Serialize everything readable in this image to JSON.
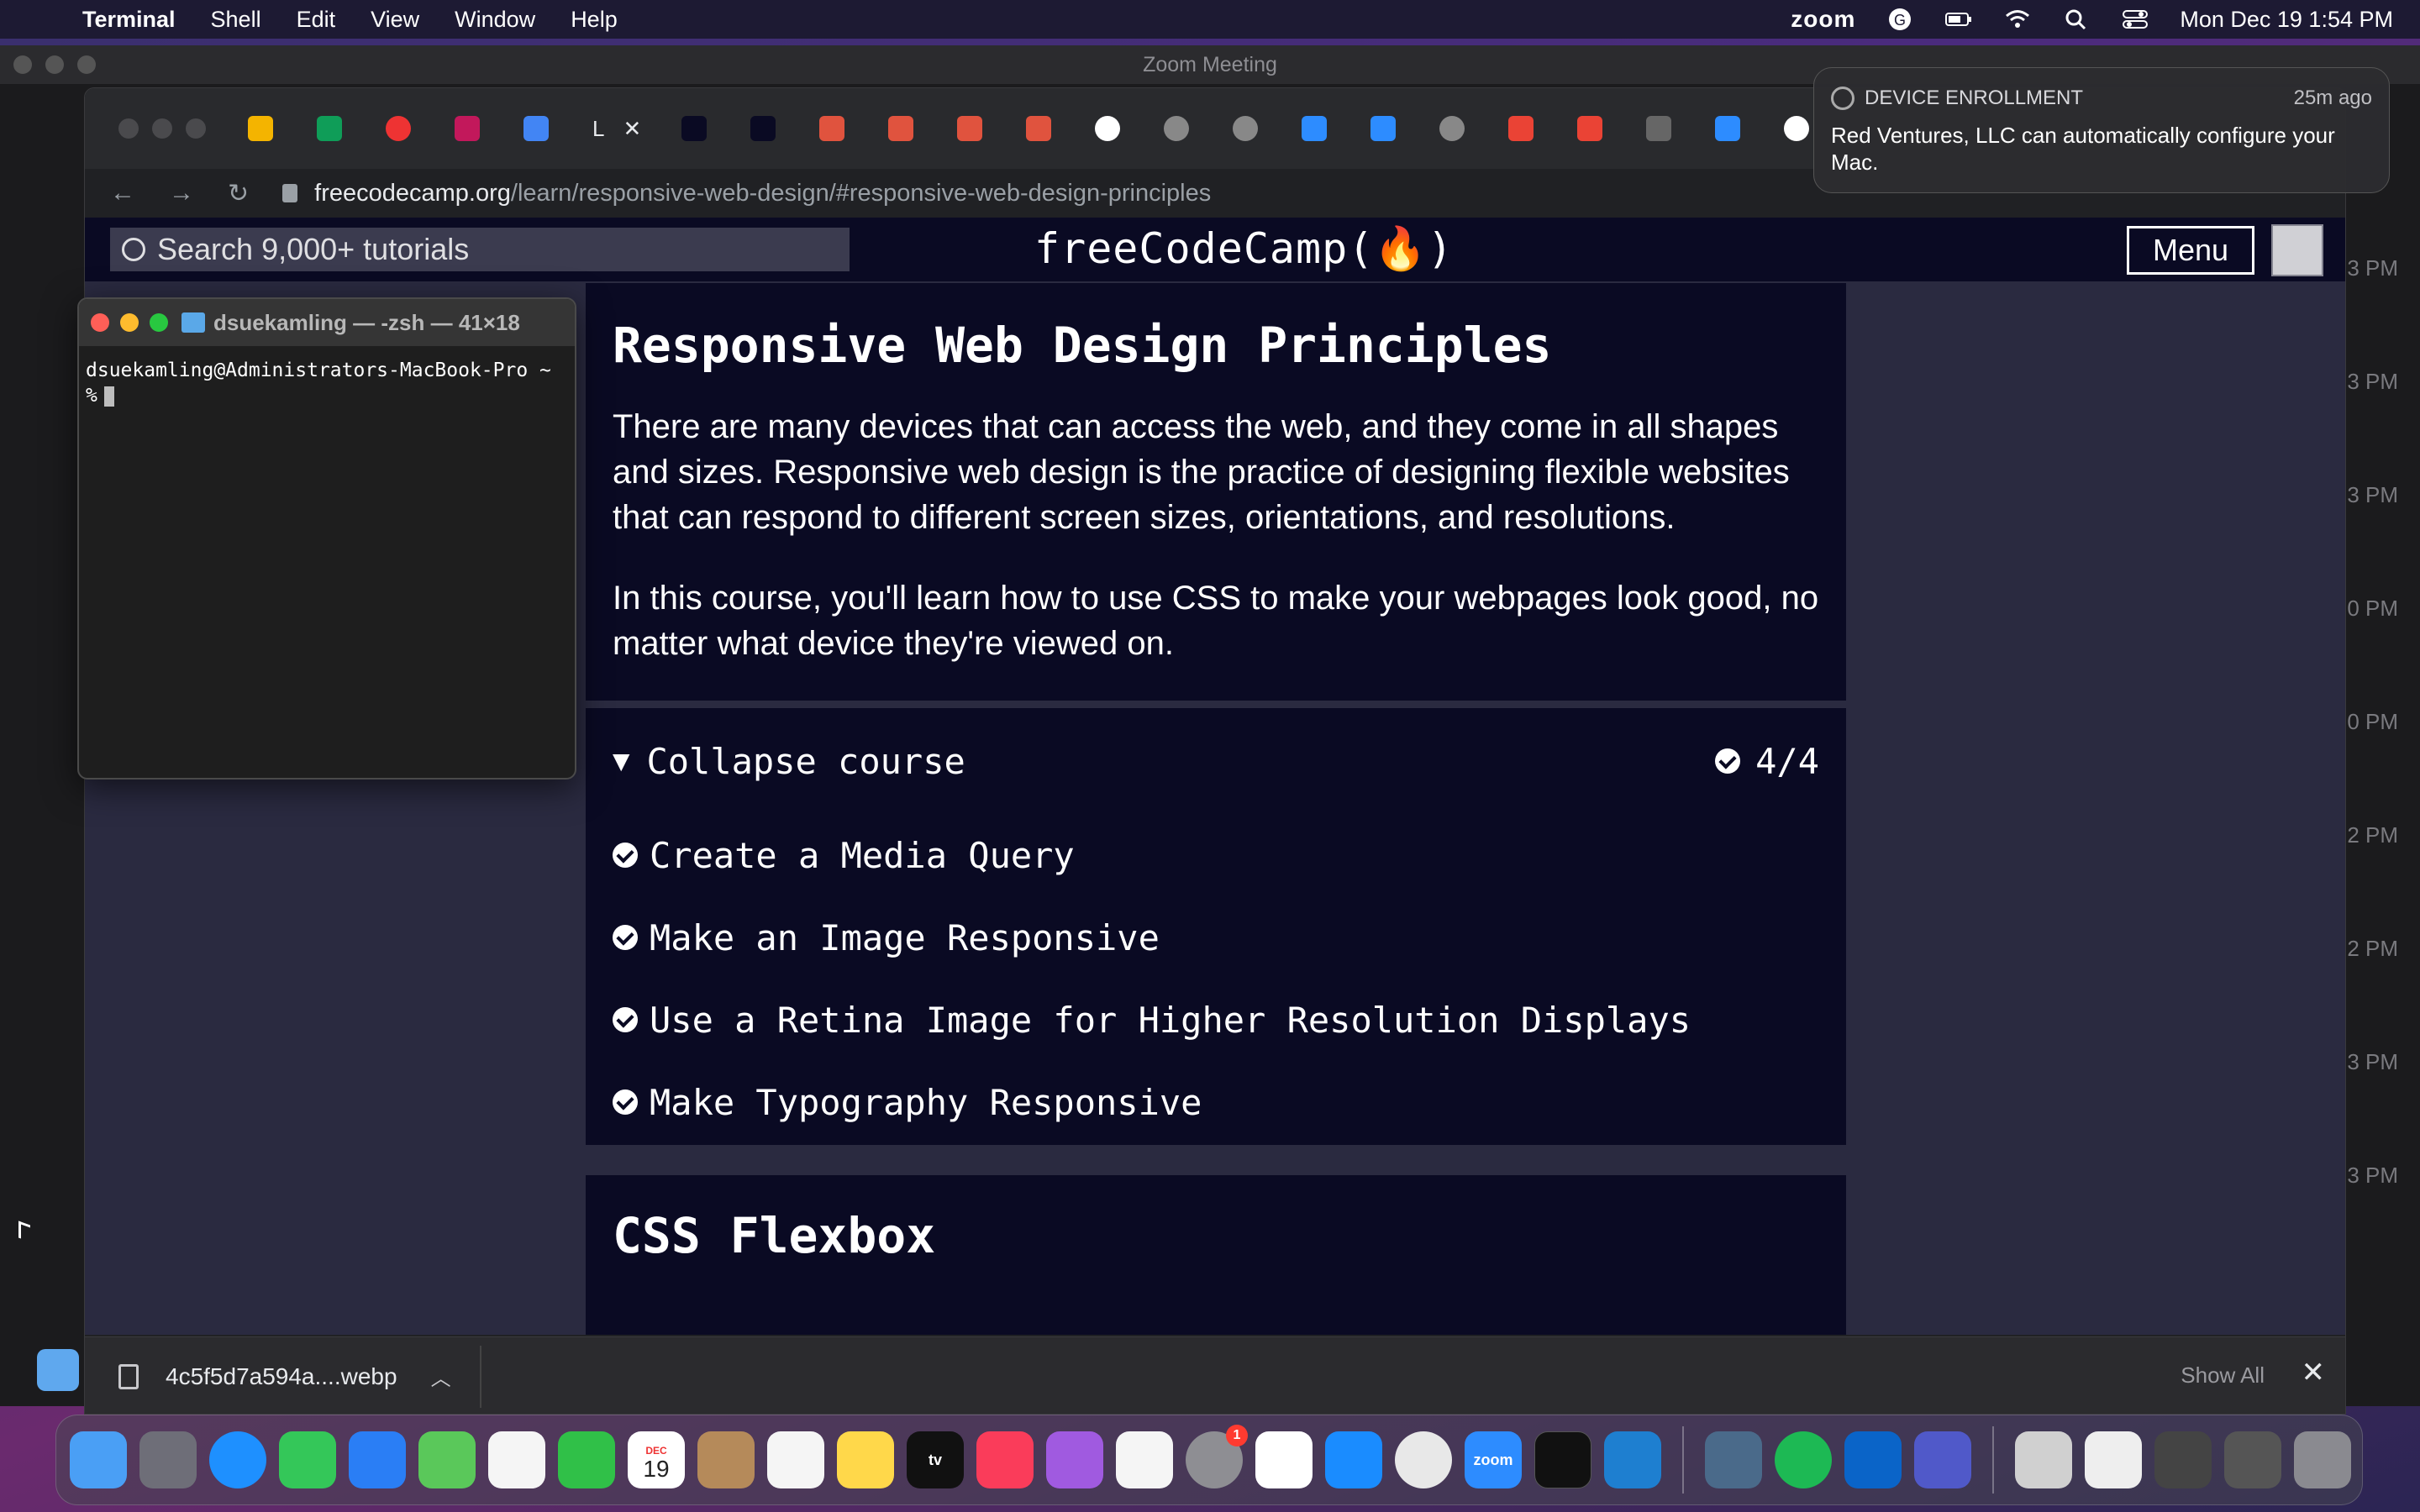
{
  "menubar": {
    "app_name": "Terminal",
    "items": [
      "Shell",
      "Edit",
      "View",
      "Window",
      "Help"
    ],
    "zoom_label": "zoom",
    "datetime": "Mon Dec 19  1:54 PM"
  },
  "zoom_window": {
    "title": "Zoom Meeting",
    "times": [
      "3 PM",
      "3 PM",
      "3 PM",
      "0 PM",
      "0 PM",
      "2 PM",
      "2 PM",
      "3 PM",
      "3 PM"
    ]
  },
  "browser": {
    "active_tab_label": "L",
    "url_host": "freecodecamp.org",
    "url_path": "/learn/responsive-web-design/#responsive-web-design-principles"
  },
  "fcc": {
    "search_placeholder": "Search 9,000+ tutorials",
    "logo": "freeCodeCamp(🔥)",
    "menu_label": "Menu",
    "intro": {
      "title": "Responsive Web Design Principles",
      "paragraphs": [
        "There are many devices that can access the web, and they come in all shapes and sizes. Responsive web design is the practice of designing flexible websites that can respond to different screen sizes, orientations, and resolutions.",
        "In this course, you'll learn how to use CSS to make your webpages look good, no matter what device they're viewed on."
      ]
    },
    "course": {
      "toggle_label": "Collapse course",
      "progress": "4/4",
      "lessons": [
        "Create a Media Query",
        "Make an Image Responsive",
        "Use a Retina Image for Higher Resolution Displays",
        "Make Typography Responsive"
      ]
    },
    "next_section_title": "CSS Flexbox"
  },
  "download_bar": {
    "filename": "4c5f5d7a594a....webp",
    "show_all": "Show All",
    "close": "✕"
  },
  "terminal": {
    "title": "dsuekamling — -zsh — 41×18",
    "line1": "dsuekamling@Administrators-MacBook-Pro ~",
    "prompt": "%"
  },
  "notification": {
    "app": "DEVICE ENROLLMENT",
    "time": "25m ago",
    "message": "Red Ventures, LLC can automatically configure your Mac."
  },
  "dock": {
    "calendar_month": "DEC",
    "calendar_day": "19",
    "zoom_label": "zoom",
    "settings_badge": "1",
    "tv_label": "tv"
  },
  "colors": {
    "fcc_bg": "#0a0a23",
    "fcc_page": "#2a2a40",
    "accent_check": "#ffffff"
  }
}
